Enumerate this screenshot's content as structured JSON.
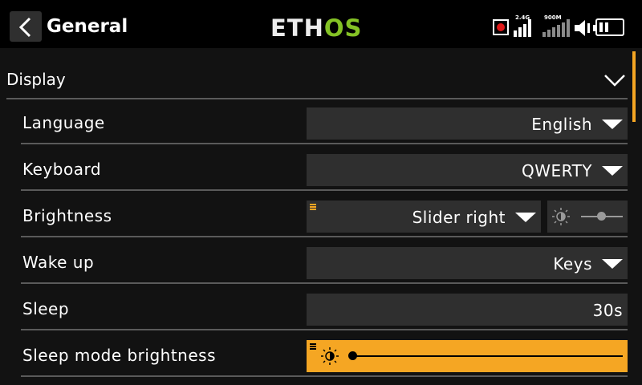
{
  "header": {
    "back_label": "<",
    "title": "General",
    "logo_part1": "ETH",
    "logo_part2": "OS",
    "signal_24_label": "2.4G",
    "signal_900_label": "900M",
    "icons": [
      "back-arrow-icon",
      "record-icon",
      "signal-bars-icon",
      "speaker-icon",
      "battery-icon"
    ]
  },
  "colors": {
    "accent": "#f5a623",
    "logo_green": "#84c225",
    "field_bg": "#2f2f2f",
    "record_red": "#e01818"
  },
  "section": {
    "title": "Display",
    "expanded": true
  },
  "rows": [
    {
      "label": "Language",
      "value": "English"
    },
    {
      "label": "Keyboard",
      "value": "QWERTY"
    },
    {
      "label": "Brightness",
      "value": "Slider right"
    },
    {
      "label": "Wake up",
      "value": "Keys"
    },
    {
      "label": "Sleep",
      "value": "30s"
    },
    {
      "label": "Sleep mode brightness",
      "slider_level": 0
    }
  ]
}
